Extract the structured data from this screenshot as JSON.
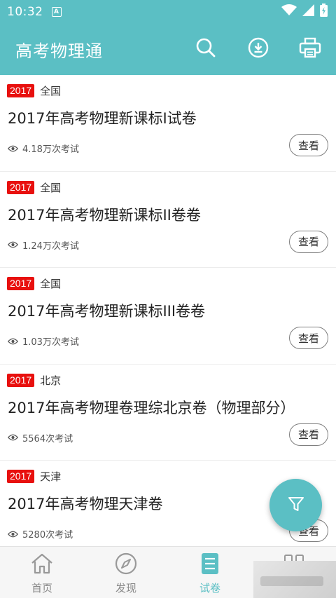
{
  "status_bar": {
    "time": "10:32",
    "notification_badge": "A"
  },
  "app_bar": {
    "title": "高考物理通",
    "icons": [
      "search-icon",
      "download-icon",
      "print-icon"
    ]
  },
  "colors": {
    "primary": "#5bbfc4",
    "year_badge": "#e8100e"
  },
  "papers": [
    {
      "year": "2017",
      "region": "全国",
      "title": "2017年高考物理新课标I试卷",
      "views": "4.18万次考试",
      "action": "查看"
    },
    {
      "year": "2017",
      "region": "全国",
      "title": "2017年高考物理新课标II卷卷",
      "views": "1.24万次考试",
      "action": "查看"
    },
    {
      "year": "2017",
      "region": "全国",
      "title": "2017年高考物理新课标III卷卷",
      "views": "1.03万次考试",
      "action": "查看"
    },
    {
      "year": "2017",
      "region": "北京",
      "title": "2017年高考物理卷理综北京卷（物理部分）",
      "views": "5564次考试",
      "action": "查看"
    },
    {
      "year": "2017",
      "region": "天津",
      "title": "2017年高考物理天津卷",
      "views": "5280次考试",
      "action": "查看"
    }
  ],
  "fab": {
    "icon": "filter-icon"
  },
  "bottom_nav": {
    "tabs": [
      {
        "label": "首页",
        "icon": "home-icon",
        "active": false
      },
      {
        "label": "发现",
        "icon": "compass-icon",
        "active": false
      },
      {
        "label": "试卷",
        "icon": "list-icon",
        "active": true
      }
    ]
  }
}
